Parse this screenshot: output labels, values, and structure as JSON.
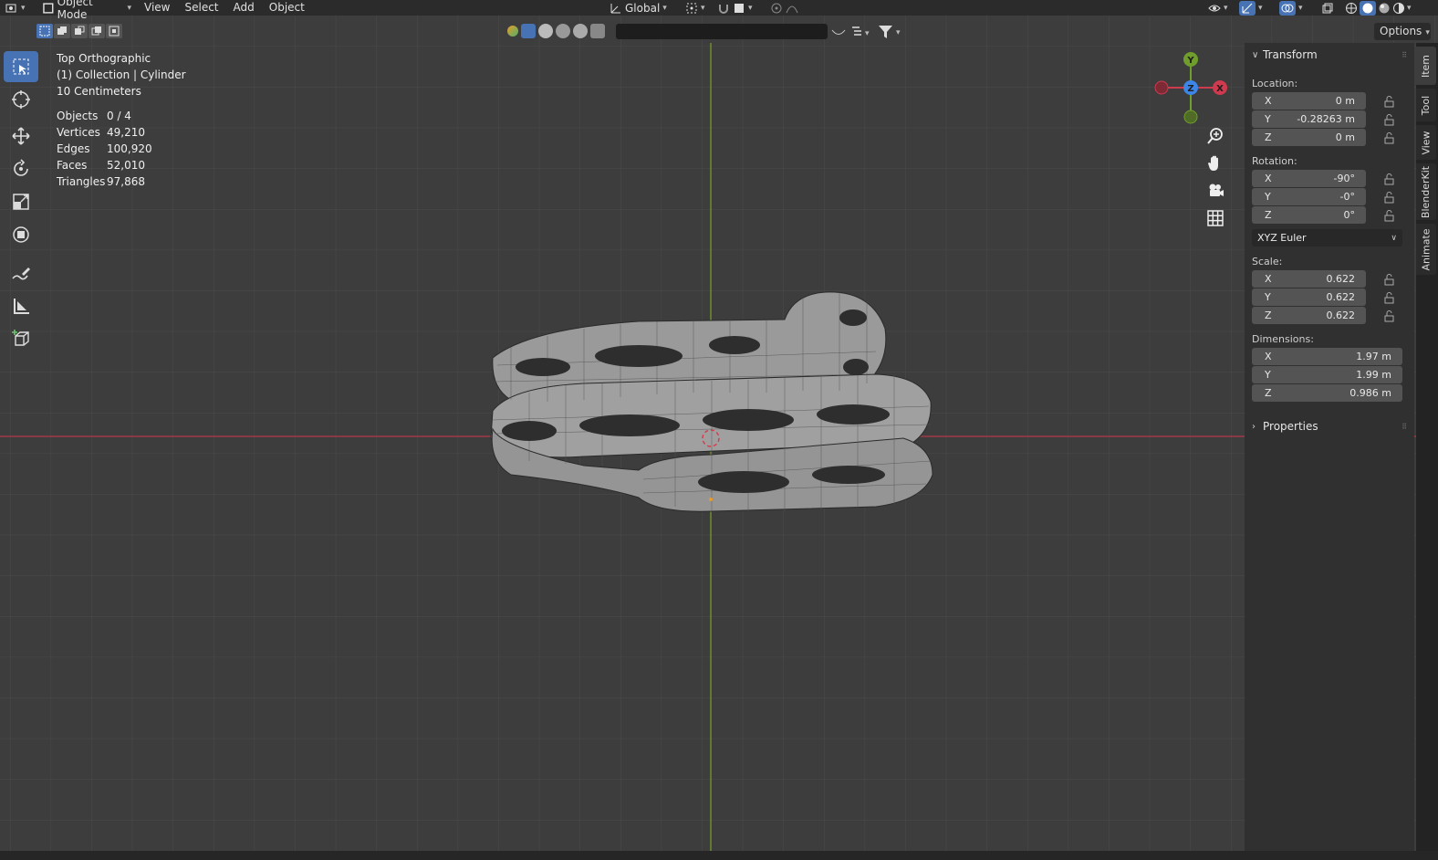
{
  "header": {
    "mode_label": "Object Mode",
    "menus": [
      "View",
      "Select",
      "Add",
      "Object"
    ],
    "transform_orientation": "Global"
  },
  "subbar": {
    "options_label": "Options",
    "search_placeholder": ""
  },
  "viewport": {
    "view_name": "Top Orthographic",
    "collection_info": "(1) Collection | Cylinder",
    "scale_info": "10 Centimeters",
    "stats": [
      {
        "label": "Objects",
        "value": "0 / 4"
      },
      {
        "label": "Vertices",
        "value": "49,210"
      },
      {
        "label": "Edges",
        "value": "100,920"
      },
      {
        "label": "Faces",
        "value": "52,010"
      },
      {
        "label": "Triangles",
        "value": "97,868"
      }
    ],
    "gizmo": {
      "y": "Y",
      "z": "Z",
      "x": "X"
    }
  },
  "npanel": {
    "transform_title": "Transform",
    "location_label": "Location:",
    "location": [
      {
        "axis": "X",
        "value": "0 m"
      },
      {
        "axis": "Y",
        "value": "-0.28263 m"
      },
      {
        "axis": "Z",
        "value": "0 m"
      }
    ],
    "rotation_label": "Rotation:",
    "rotation": [
      {
        "axis": "X",
        "value": "-90°"
      },
      {
        "axis": "Y",
        "value": "-0°"
      },
      {
        "axis": "Z",
        "value": "0°"
      }
    ],
    "rotation_mode": "XYZ Euler",
    "scale_label": "Scale:",
    "scale": [
      {
        "axis": "X",
        "value": "0.622"
      },
      {
        "axis": "Y",
        "value": "0.622"
      },
      {
        "axis": "Z",
        "value": "0.622"
      }
    ],
    "dimensions_label": "Dimensions:",
    "dimensions": [
      {
        "axis": "X",
        "value": "1.97 m"
      },
      {
        "axis": "Y",
        "value": "1.99 m"
      },
      {
        "axis": "Z",
        "value": "0.986 m"
      }
    ],
    "properties_title": "Properties"
  },
  "vtabs": [
    "Item",
    "Tool",
    "View",
    "BlenderKit",
    "Animate"
  ],
  "colors": {
    "accent": "#4772b3",
    "x_axis": "#cf3a4f",
    "y_axis": "#6f9e2d",
    "z_axis": "#3d86e8"
  }
}
